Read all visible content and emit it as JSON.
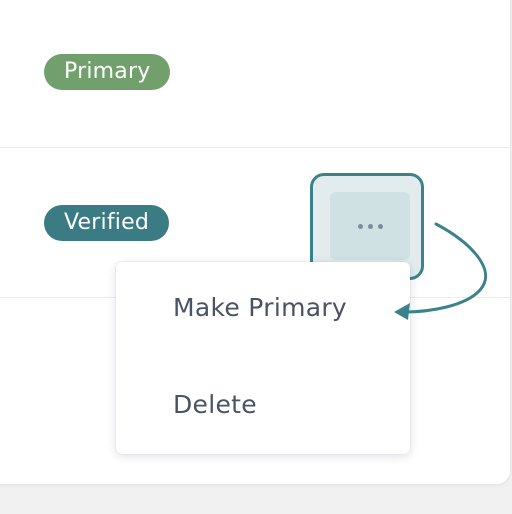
{
  "rows": [
    {
      "badge": {
        "label": "Primary",
        "color": "#72a06c"
      }
    },
    {
      "badge": {
        "label": "Verified",
        "color": "#3b7b83"
      }
    }
  ],
  "actions": {
    "more_icon": "more-horizontal-icon",
    "highlight_color": "#3b828a"
  },
  "menu": {
    "items": [
      {
        "label": "Make Primary"
      },
      {
        "label": "Delete"
      }
    ]
  }
}
